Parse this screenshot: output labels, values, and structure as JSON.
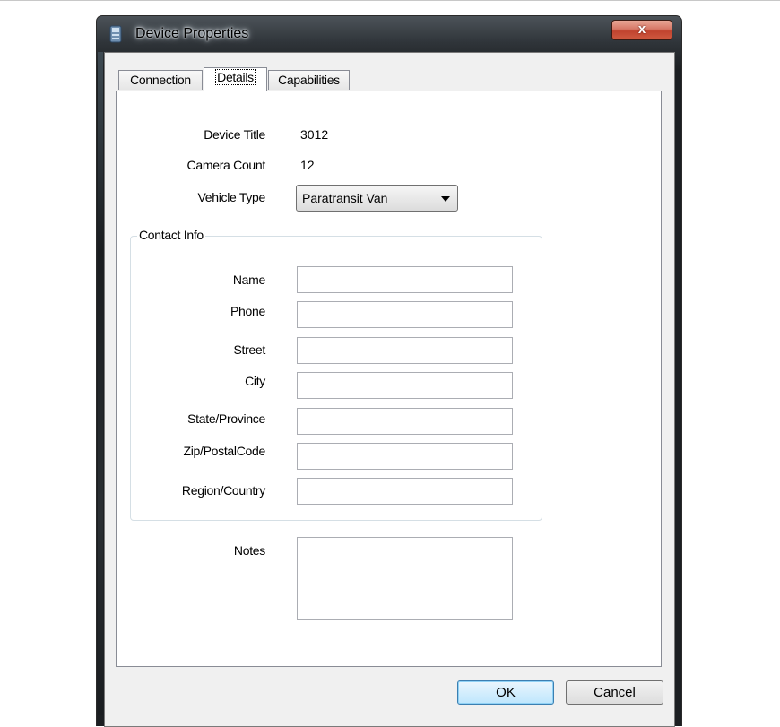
{
  "window": {
    "title": "Device Properties",
    "close_label": "x"
  },
  "tabs": [
    {
      "label": "Connection"
    },
    {
      "label": "Details"
    },
    {
      "label": "Capabilities"
    }
  ],
  "details": {
    "device_title_label": "Device Title",
    "device_title_value": "3012",
    "camera_count_label": "Camera Count",
    "camera_count_value": "12",
    "vehicle_type_label": "Vehicle Type",
    "vehicle_type_value": "Paratransit Van"
  },
  "contact": {
    "legend": "Contact Info",
    "fields": [
      {
        "label": "Name",
        "value": ""
      },
      {
        "label": "Phone",
        "value": ""
      },
      {
        "label": "Street",
        "value": ""
      },
      {
        "label": "City",
        "value": ""
      },
      {
        "label": "State/Province",
        "value": ""
      },
      {
        "label": "Zip/PostalCode",
        "value": ""
      },
      {
        "label": "Region/Country",
        "value": ""
      }
    ]
  },
  "notes": {
    "label": "Notes",
    "value": ""
  },
  "buttons": {
    "ok": "OK",
    "cancel": "Cancel"
  },
  "colors": {
    "close_button": "#c0432e",
    "frame": "#1c1f22",
    "default_button": "#bee6fd"
  },
  "icons": {
    "app": "device-app-icon",
    "close": "close-icon",
    "dropdown": "chevron-down-icon"
  }
}
